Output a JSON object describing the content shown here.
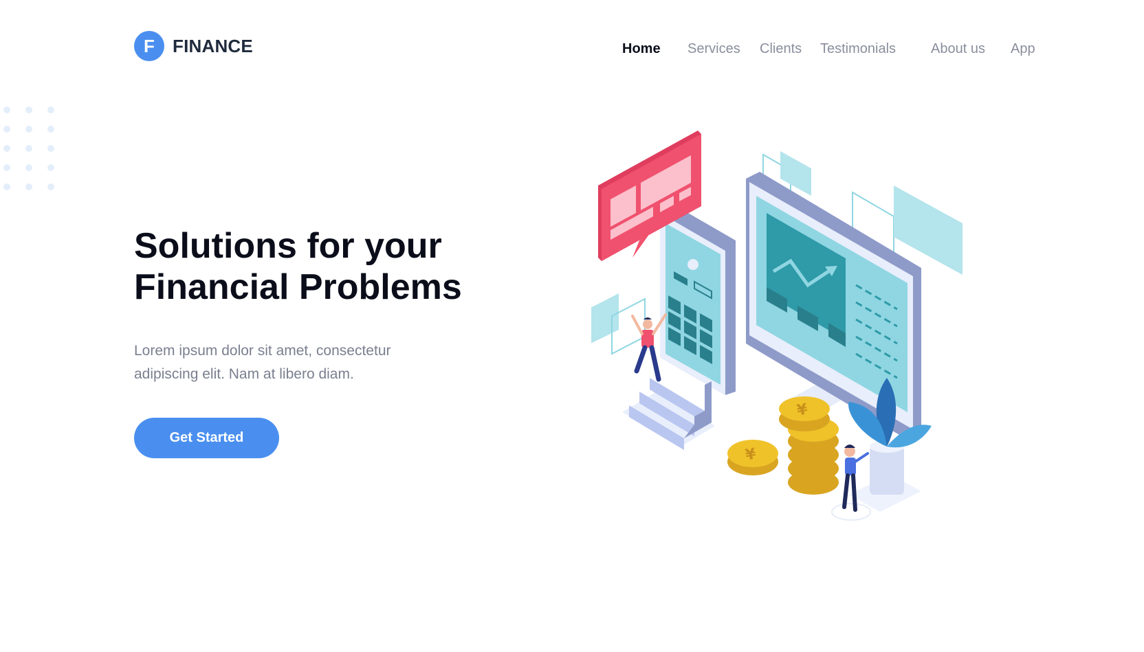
{
  "brand": {
    "logo_letter": "F",
    "name": "FINANCE",
    "accent": "#4a8ff0"
  },
  "nav": {
    "items": [
      {
        "label": "Home",
        "active": true
      },
      {
        "label": "Services",
        "active": false
      },
      {
        "label": "Clients",
        "active": false
      },
      {
        "label": "Testimonials",
        "active": false
      },
      {
        "label": "About us",
        "active": false
      },
      {
        "label": "App",
        "active": false
      }
    ]
  },
  "hero": {
    "title_line1": "Solutions for your",
    "title_line2": "Financial Problems",
    "subtitle": "Lorem ipsum dolor sit amet, consectetur adipiscing elit. Nam at libero diam.",
    "cta_label": "Get Started"
  },
  "illustration": {
    "icons": [
      "chat-bubble-icon",
      "smartphone-icon",
      "monitor-icon",
      "trend-arrow-icon",
      "coin-stack-icon",
      "plant-icon",
      "person-icon"
    ],
    "colors": {
      "pink": "#f0516e",
      "teal": "#2f9aa8",
      "lightTeal": "#8fd6e2",
      "monitor": "#8e9bc9",
      "gold": "#f0c22a",
      "blue": "#2a6fb5"
    }
  }
}
